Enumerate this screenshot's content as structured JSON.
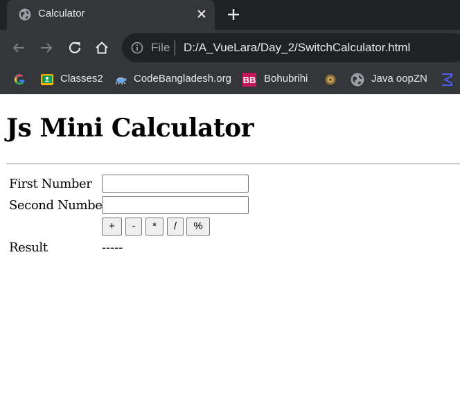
{
  "browser": {
    "tab": {
      "title": "Calculator"
    },
    "address_bar": {
      "scheme": "File",
      "url": "D:/A_VueLara/Day_2/SwitchCalculator.html"
    },
    "bookmarks": [
      {
        "icon": "google-icon",
        "label": ""
      },
      {
        "icon": "classroom-icon",
        "label": "Classes2"
      },
      {
        "icon": "turtle-icon",
        "label": "CodeBangladesh.org"
      },
      {
        "icon": "bb-logo-icon",
        "label": "Bohubrihi"
      },
      {
        "icon": "emblem-icon",
        "label": ""
      },
      {
        "icon": "globe-icon",
        "label": "Java oopZN"
      },
      {
        "icon": "sigma-icon",
        "label": ""
      }
    ]
  },
  "page": {
    "title": "Js Mini Calculator",
    "first_label": "First Number",
    "first_value": "",
    "second_label": "Second Number",
    "second_value": "",
    "operators": [
      "+",
      "-",
      "*",
      "/",
      "%"
    ],
    "result_label": "Result",
    "result_value": "-----"
  },
  "colors": {
    "tabstrip": "#202124",
    "toolbar": "#35363a",
    "omnibox": "#202124",
    "chrome_text": "#e8eaed"
  }
}
